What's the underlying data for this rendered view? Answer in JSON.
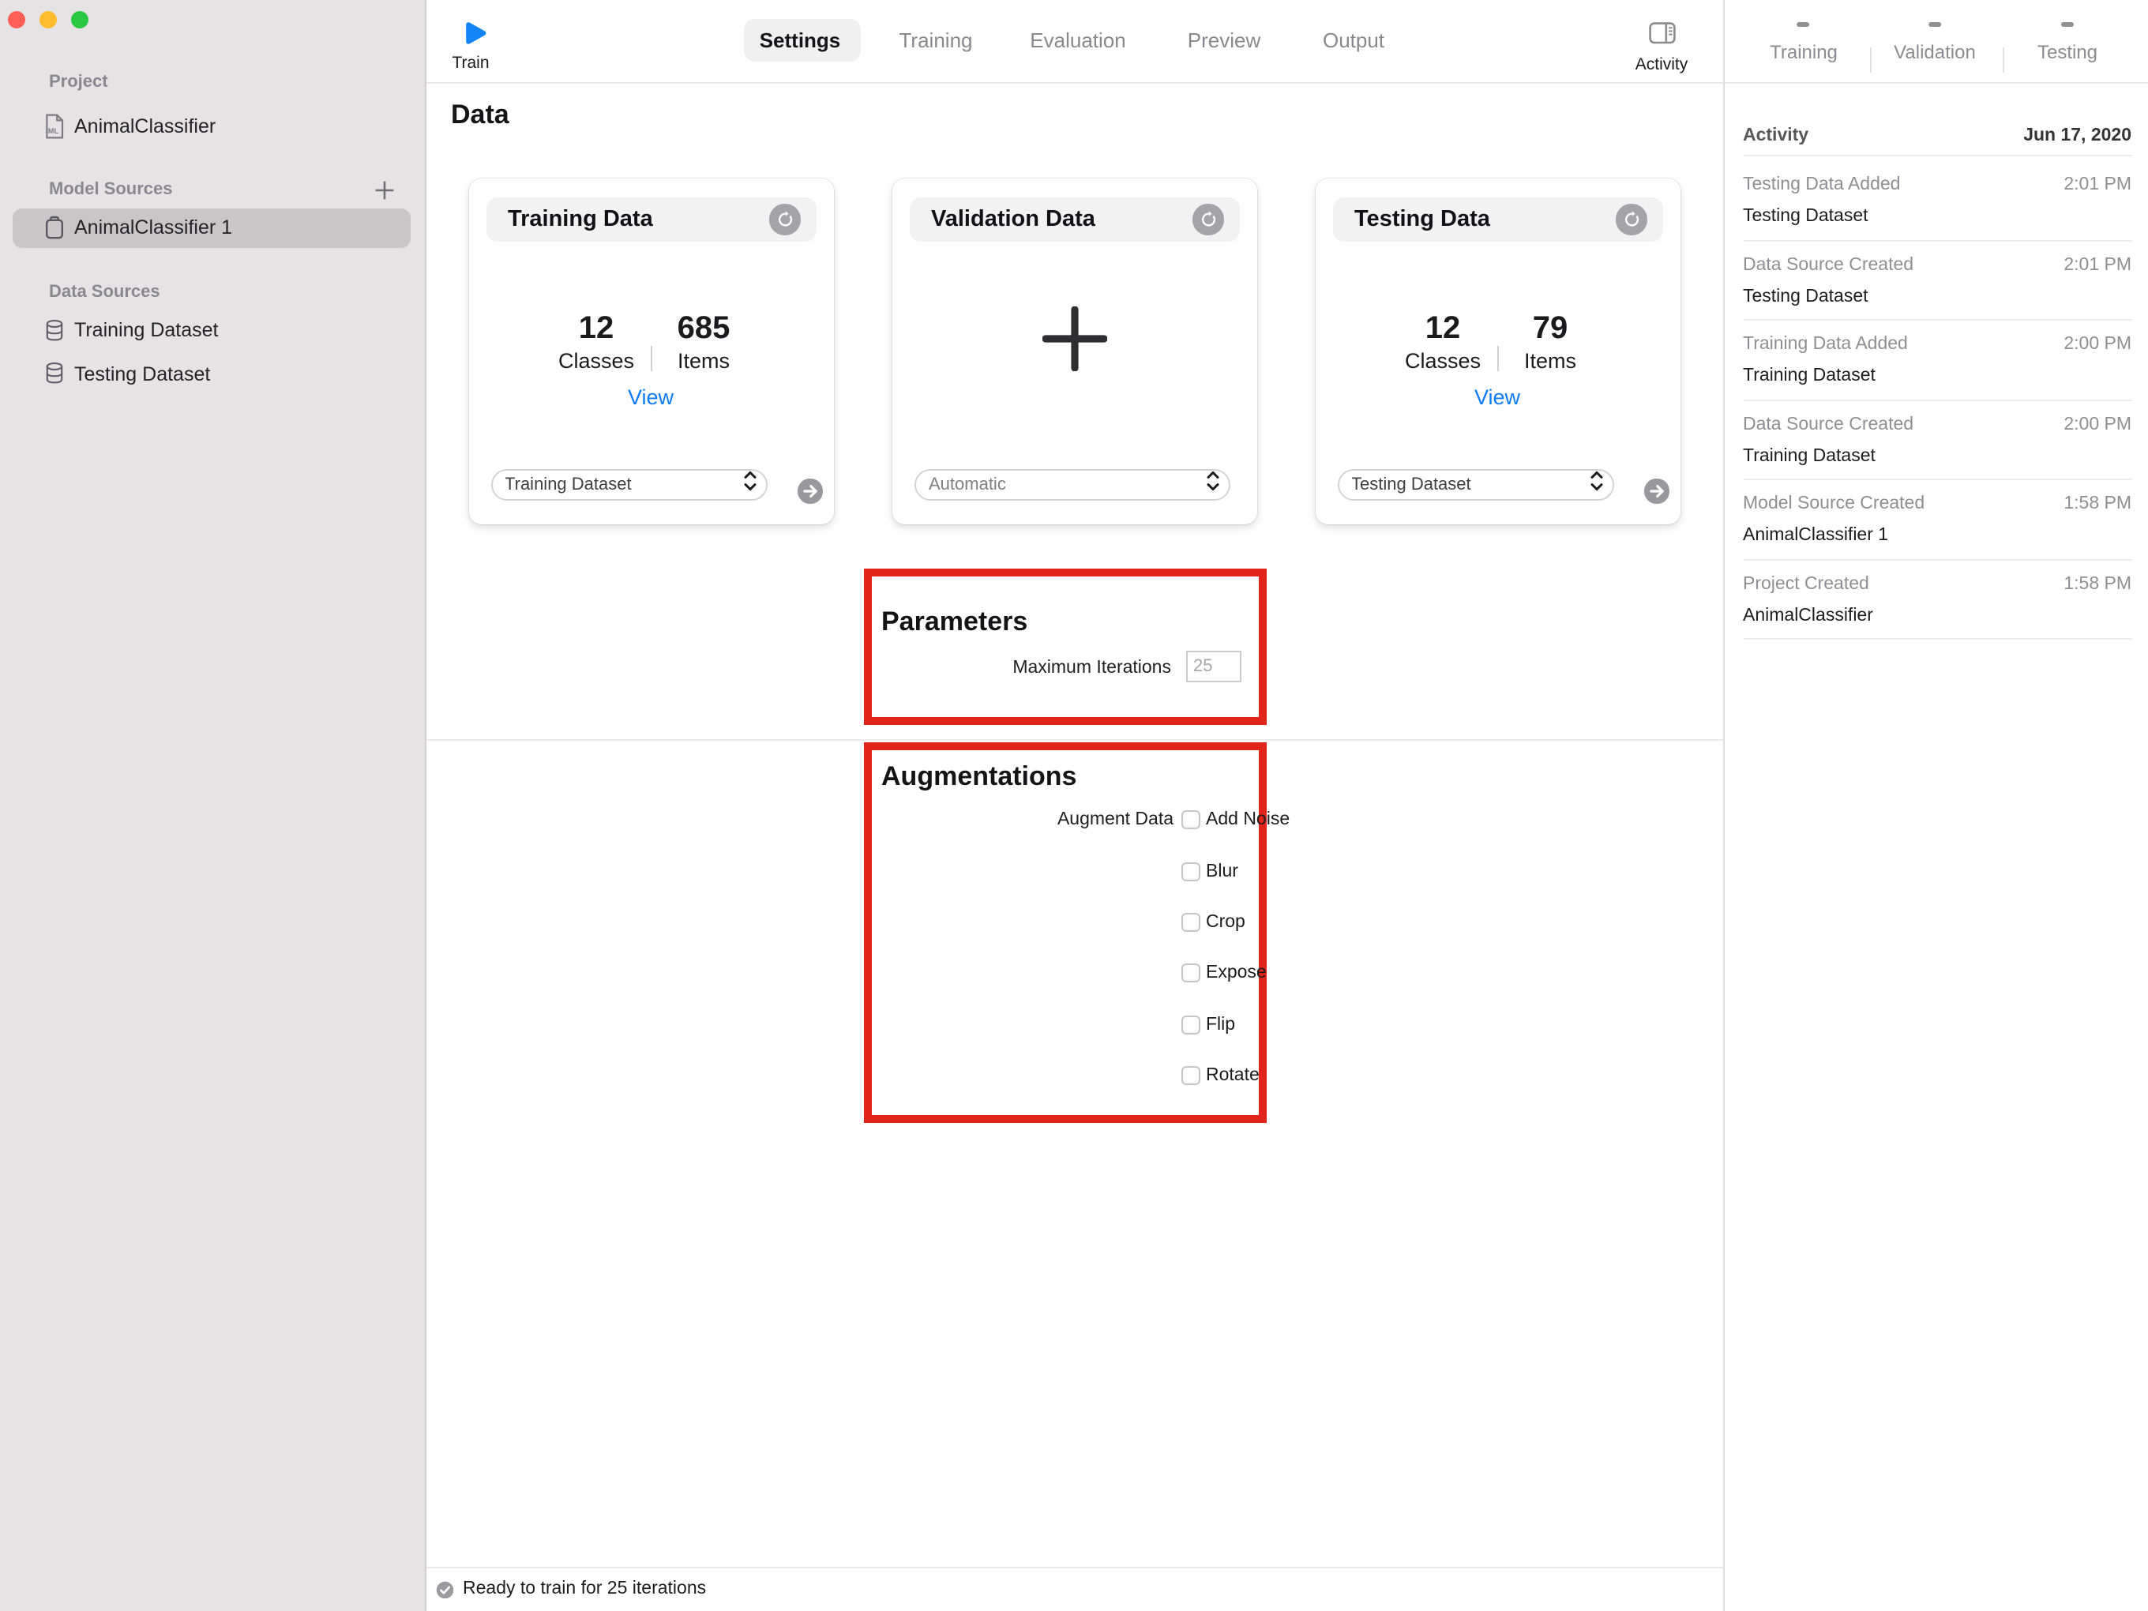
{
  "colors": {
    "accent_blue": "#0d7cf4",
    "annotation_red": "#e1251b",
    "traffic_red": "#ff5f57",
    "traffic_yellow": "#febc2e",
    "traffic_green": "#28c840",
    "sidebar_bg": "#e5e3e4",
    "selected_row_bg": "#c8c6c7"
  },
  "sidebar": {
    "project_label": "Project",
    "project_item": "AnimalClassifier",
    "model_sources_label": "Model Sources",
    "model_source_item": "AnimalClassifier 1",
    "data_sources_label": "Data Sources",
    "data_source_items": [
      {
        "label": "Training Dataset"
      },
      {
        "label": "Testing Dataset"
      }
    ]
  },
  "toolbar": {
    "train_label": "Train",
    "tabs": [
      {
        "label": "Settings",
        "selected": true
      },
      {
        "label": "Training",
        "selected": false
      },
      {
        "label": "Evaluation",
        "selected": false
      },
      {
        "label": "Preview",
        "selected": false
      },
      {
        "label": "Output",
        "selected": false
      }
    ],
    "activity_label": "Activity"
  },
  "main": {
    "title": "Data",
    "cards": [
      {
        "title": "Training Data",
        "classes_value": "12",
        "classes_label": "Classes",
        "items_value": "685",
        "items_label": "Items",
        "view_label": "View",
        "dropdown_value": "Training Dataset"
      },
      {
        "title": "Validation Data",
        "dropdown_value": "Automatic"
      },
      {
        "title": "Testing Data",
        "classes_value": "12",
        "classes_label": "Classes",
        "items_value": "79",
        "items_label": "Items",
        "view_label": "View",
        "dropdown_value": "Testing Dataset"
      }
    ],
    "parameters": {
      "heading": "Parameters",
      "max_iterations_label": "Maximum Iterations",
      "max_iterations_value": "25"
    },
    "augmentations": {
      "heading": "Augmentations",
      "augment_data_label": "Augment Data",
      "options": [
        {
          "label": "Add Noise",
          "checked": false
        },
        {
          "label": "Blur",
          "checked": false
        },
        {
          "label": "Crop",
          "checked": false
        },
        {
          "label": "Expose",
          "checked": false
        },
        {
          "label": "Flip",
          "checked": false
        },
        {
          "label": "Rotate",
          "checked": false
        }
      ]
    },
    "status_text": "Ready to train for 25 iterations"
  },
  "panel": {
    "tabs": [
      {
        "label": "Training",
        "value": "–"
      },
      {
        "label": "Validation",
        "value": "–"
      },
      {
        "label": "Testing",
        "value": "–"
      }
    ],
    "activity_header": "Activity",
    "activity_date": "Jun 17, 2020",
    "events": [
      {
        "title": "Testing Data Added",
        "time": "2:01 PM",
        "subject": "Testing Dataset"
      },
      {
        "title": "Data Source Created",
        "time": "2:01 PM",
        "subject": "Testing Dataset"
      },
      {
        "title": "Training Data Added",
        "time": "2:00 PM",
        "subject": "Training Dataset"
      },
      {
        "title": "Data Source Created",
        "time": "2:00 PM",
        "subject": "Training Dataset"
      },
      {
        "title": "Model Source Created",
        "time": "1:58 PM",
        "subject": "AnimalClassifier 1"
      },
      {
        "title": "Project Created",
        "time": "1:58 PM",
        "subject": "AnimalClassifier"
      }
    ]
  }
}
